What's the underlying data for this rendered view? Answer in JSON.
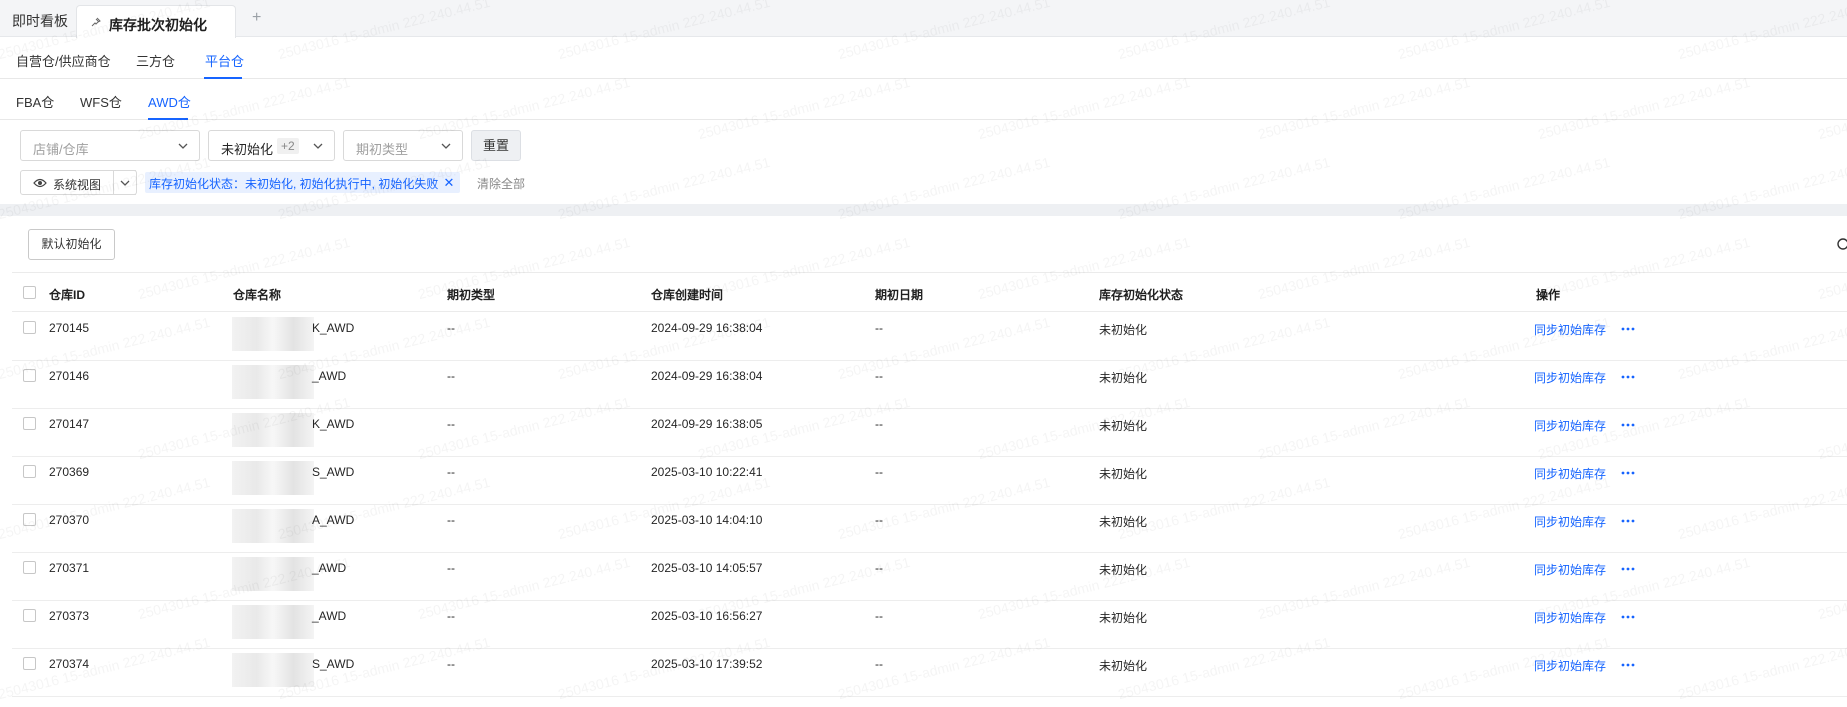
{
  "top_tabs": {
    "dashboard": "即时看板",
    "active": "库存批次初始化",
    "add": "+"
  },
  "level1_tabs": [
    {
      "label": "自营仓/供应商仓",
      "active": false
    },
    {
      "label": "三方仓",
      "active": false
    },
    {
      "label": "平台仓",
      "active": true
    }
  ],
  "level2_tabs": [
    {
      "label": "FBA仓",
      "active": false
    },
    {
      "label": "WFS仓",
      "active": false
    },
    {
      "label": "AWD仓",
      "active": true
    }
  ],
  "filters": {
    "store_placeholder": "店铺/仓库",
    "status_value": "未初始化",
    "status_extra": "+2",
    "period_type_placeholder": "期初类型",
    "reset": "重置"
  },
  "view": {
    "label": "系统视图",
    "filter_tag": "库存初始化状态：未初始化, 初始化执行中, 初始化失败",
    "clear_all": "清除全部"
  },
  "toolbar": {
    "default_init": "默认初始化"
  },
  "table": {
    "headers": [
      "仓库ID",
      "仓库名称",
      "期初类型",
      "仓库创建时间",
      "期初日期",
      "库存初始化状态",
      "操作"
    ],
    "rows": [
      {
        "id": "270145",
        "name": "K_AWD",
        "period_type": "--",
        "created": "2024-09-29 16:38:04",
        "period_date": "--",
        "status": "未初始化",
        "action": "同步初始库存"
      },
      {
        "id": "270146",
        "name": "_AWD",
        "period_type": "--",
        "created": "2024-09-29 16:38:04",
        "period_date": "--",
        "status": "未初始化",
        "action": "同步初始库存"
      },
      {
        "id": "270147",
        "name": "K_AWD",
        "period_type": "--",
        "created": "2024-09-29 16:38:05",
        "period_date": "--",
        "status": "未初始化",
        "action": "同步初始库存"
      },
      {
        "id": "270369",
        "name": "S_AWD",
        "period_type": "--",
        "created": "2025-03-10 10:22:41",
        "period_date": "--",
        "status": "未初始化",
        "action": "同步初始库存"
      },
      {
        "id": "270370",
        "name": "A_AWD",
        "period_type": "--",
        "created": "2025-03-10 14:04:10",
        "period_date": "--",
        "status": "未初始化",
        "action": "同步初始库存"
      },
      {
        "id": "270371",
        "name": "_AWD",
        "period_type": "--",
        "created": "2025-03-10 14:05:57",
        "period_date": "--",
        "status": "未初始化",
        "action": "同步初始库存"
      },
      {
        "id": "270373",
        "name": "_AWD",
        "period_type": "--",
        "created": "2025-03-10 16:56:27",
        "period_date": "--",
        "status": "未初始化",
        "action": "同步初始库存"
      },
      {
        "id": "270374",
        "name": "S_AWD",
        "period_type": "--",
        "created": "2025-03-10 17:39:52",
        "period_date": "--",
        "status": "未初始化",
        "action": "同步初始库存"
      }
    ]
  },
  "watermark": "25043016 15-admin 222.240.44.51",
  "colors": {
    "accent": "#1664ff",
    "tag_bg": "#e8f0ff",
    "gap_bg": "#eef0f3"
  }
}
